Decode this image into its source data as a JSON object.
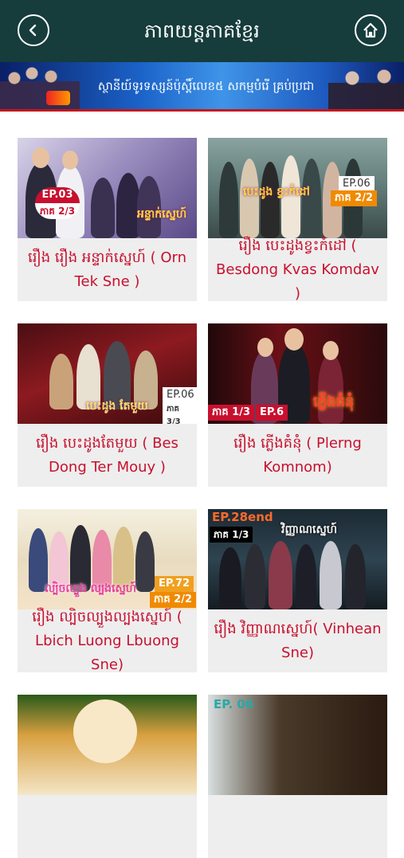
{
  "header": {
    "title": "ភាពយន្តភាគខ្មែរ",
    "back_icon": "chevron-left-icon",
    "home_icon": "home-icon"
  },
  "banner": {
    "text": "ស្ថានីយ៍ទូរទស្សន៍ប៉ុស្តិ៍លេខ៥ សកម្មបំរើ គ្រប់ប្រជា"
  },
  "colors": {
    "topbar": "#163c3c",
    "caption_text": "#c8102e",
    "card_bg": "#eeeeee"
  },
  "items": [
    {
      "caption": "រឿង រឿង អន្ទាក់ស្នេហ៍ ( Orn Tek Sne )",
      "ep": "EP.03",
      "part": "ភាគ 2/3"
    },
    {
      "caption": "រឿង បេះដូងខ្វះកំដៅ ( Besdong Kvas Komdav )",
      "ep": "EP.06",
      "part": "ភាគ 2/2"
    },
    {
      "caption": "រឿង បេះដូងតែមួយ ( Bes Dong Ter Mouy )",
      "ep": "EP.06",
      "part": "ភាគ 3/3"
    },
    {
      "caption": "រឿង ភ្លើងគំនុំ ( Plerng Komnom)",
      "ep": "EP.6",
      "part": "ភាគ 1/3"
    },
    {
      "caption": "រឿង ល្បិចល្បួងល្បងស្នេហ៍ ( Lbich Luong Lbuong Sne)",
      "ep": "EP.72",
      "part": "ភាគ 2/2"
    },
    {
      "caption": "រឿង វិញ្ញាណស្នេហ៍( Vinhean Sne)",
      "ep": "EP.28end",
      "part": "ភាគ 1/3"
    },
    {
      "caption": "",
      "ep": "",
      "part": ""
    },
    {
      "caption": "",
      "ep": "EP. 06",
      "part": ""
    }
  ]
}
